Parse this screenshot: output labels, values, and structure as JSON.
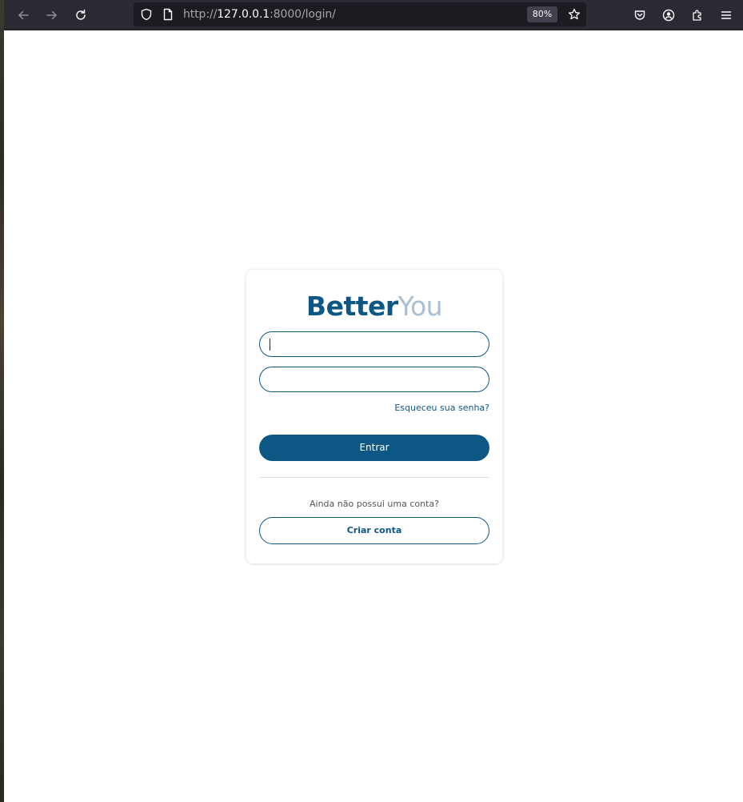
{
  "browser": {
    "url_prefix": "http://",
    "url_host": "127.0.0.1",
    "url_rest": ":8000/login/",
    "zoom": "80%",
    "icons": {
      "back": "arrow-left-icon",
      "forward": "arrow-right-icon",
      "reload": "reload-icon",
      "shield": "shield-icon",
      "page": "page-icon",
      "bookmark": "star-icon",
      "pocket": "pocket-icon",
      "account": "account-icon",
      "extensions": "puzzle-icon",
      "menu": "hamburger-menu-icon"
    }
  },
  "login": {
    "logo_bold": "Better",
    "logo_light": "You",
    "username_value": "",
    "password_value": "",
    "forgot_link": "Esqueceu sua senha?",
    "submit_label": "Entrar",
    "no_account_text": "Ainda não possui uma conta?",
    "create_account_label": "Criar conta"
  },
  "colors": {
    "primary": "#0d5784",
    "logo_light": "#a9bfd3",
    "toolbar": "#2b2a33"
  }
}
